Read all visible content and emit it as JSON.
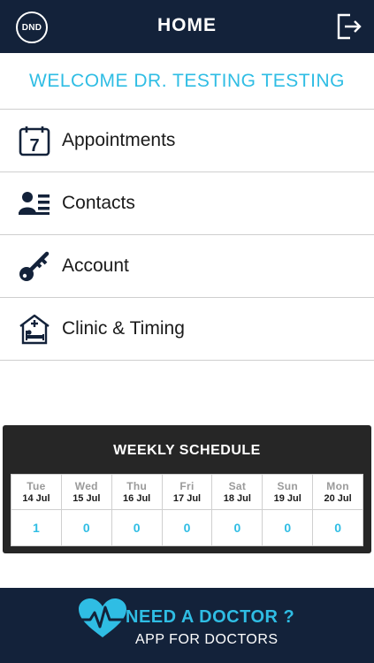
{
  "header": {
    "dnd_label": "DND",
    "title": "HOME",
    "logout_icon": "logout-icon"
  },
  "welcome": "WELCOME DR. TESTING TESTING",
  "menu": [
    {
      "label": "Appointments",
      "icon": "calendar-icon"
    },
    {
      "label": "Contacts",
      "icon": "contacts-icon"
    },
    {
      "label": "Account",
      "icon": "key-icon"
    },
    {
      "label": "Clinic & Timing",
      "icon": "clinic-icon"
    }
  ],
  "schedule": {
    "title": "WEEKLY SCHEDULE",
    "calendar_icon_day": "7",
    "days": [
      {
        "name": "Tue",
        "date": "14 Jul",
        "count": "1"
      },
      {
        "name": "Wed",
        "date": "15 Jul",
        "count": "0"
      },
      {
        "name": "Thu",
        "date": "16 Jul",
        "count": "0"
      },
      {
        "name": "Fri",
        "date": "17 Jul",
        "count": "0"
      },
      {
        "name": "Sat",
        "date": "18 Jul",
        "count": "0"
      },
      {
        "name": "Sun",
        "date": "19 Jul",
        "count": "0"
      },
      {
        "name": "Mon",
        "date": "20 Jul",
        "count": "0"
      }
    ]
  },
  "footer": {
    "line1": "NEED A DOCTOR ?",
    "line2": "APP FOR DOCTORS"
  },
  "colors": {
    "navy": "#13223a",
    "accent": "#2fbde4",
    "schedule_bg": "#262626"
  }
}
